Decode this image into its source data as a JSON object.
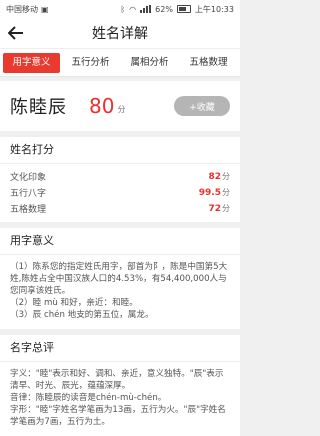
{
  "status": {
    "carrier": "中国移动",
    "battery": "62%",
    "time": "上午10:33"
  },
  "header": {
    "title": "姓名详解"
  },
  "tabs": [
    {
      "label": "用字意义",
      "active": true
    },
    {
      "label": "五行分析",
      "active": false
    },
    {
      "label": "属相分析",
      "active": false
    },
    {
      "label": "五格数理",
      "active": false
    }
  ],
  "hero": {
    "name": "陈睦辰",
    "score": "80",
    "score_unit": "分",
    "favorite_label": "+收藏"
  },
  "scores_card": {
    "title": "姓名打分",
    "rows": [
      {
        "label": "文化印象",
        "value": "82",
        "unit": "分"
      },
      {
        "label": "五行八字",
        "value": "99.5",
        "unit": "分"
      },
      {
        "label": "五格数理",
        "value": "72",
        "unit": "分"
      }
    ]
  },
  "meaning_card": {
    "title": "用字意义",
    "lines": [
      "（1）陈系您的指定姓氏用字，部首为阝，陈是中国第5大姓,陈姓占全中国汉族人口的4.53%，有54,400,000人与您同享该姓氏。",
      "（2）睦 mù 和好，亲近：和睦。",
      "（3）辰 chén 地支的第五位，属龙。"
    ]
  },
  "summary_card": {
    "title": "名字总评",
    "lines": [
      "字义：\"睦\"表示和好、调和、亲近，意义独特。\"辰\"表示清早、时光、辰光，蕴蕴深厚。",
      "音律：陈睦辰的读音是chén-mù-chén。",
      "字形：\"睦\"字姓名学笔画为13画，五行为火。\"辰\"字姓名学笔画为7画，五行为土。"
    ]
  },
  "icons": {
    "back": "back-arrow-icon"
  },
  "colors": {
    "accent": "#e83a2e",
    "score": "#e8302c",
    "button": "#b5b5b5"
  }
}
